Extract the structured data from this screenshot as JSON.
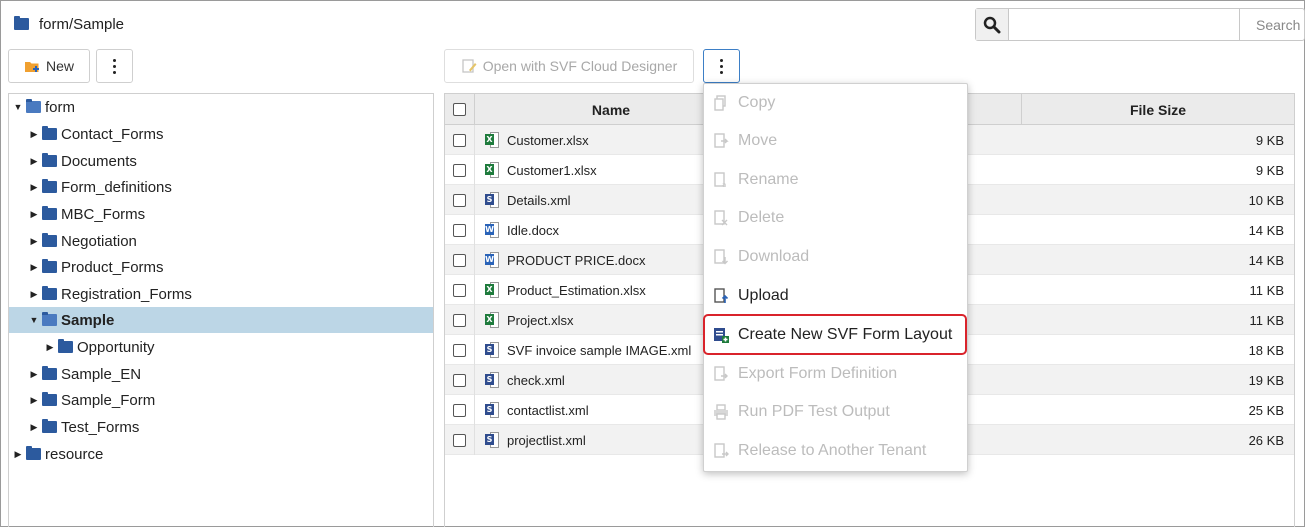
{
  "header": {
    "breadcrumb": "form/Sample"
  },
  "search": {
    "value": "",
    "label": "Search"
  },
  "toolbar": {
    "new_label": "New",
    "open_label": "Open with SVF Cloud Designer"
  },
  "tree": {
    "nodes": [
      {
        "label": "form",
        "expanded": true
      },
      {
        "label": "Contact_Forms"
      },
      {
        "label": "Documents"
      },
      {
        "label": "Form_definitions"
      },
      {
        "label": "MBC_Forms"
      },
      {
        "label": "Negotiation"
      },
      {
        "label": "Product_Forms"
      },
      {
        "label": "Registration_Forms"
      },
      {
        "label": "Sample",
        "selected": true,
        "expanded": true
      },
      {
        "label": "Opportunity"
      },
      {
        "label": "Sample_EN"
      },
      {
        "label": "Sample_Form"
      },
      {
        "label": "Test_Forms"
      },
      {
        "label": "resource"
      }
    ]
  },
  "table": {
    "headers": {
      "name": "Name",
      "size": "File Size"
    },
    "rows": [
      {
        "name": "Customer.xlsx",
        "type": "xlsx",
        "size": "9 KB"
      },
      {
        "name": "Customer1.xlsx",
        "type": "xlsx",
        "size": "9 KB"
      },
      {
        "name": "Details.xml",
        "type": "xml",
        "size": "10 KB"
      },
      {
        "name": "Idle.docx",
        "type": "docx",
        "size": "14 KB"
      },
      {
        "name": "PRODUCT PRICE.docx",
        "type": "docx",
        "size": "14 KB"
      },
      {
        "name": "Product_Estimation.xlsx",
        "type": "xlsx",
        "size": "11 KB"
      },
      {
        "name": "Project.xlsx",
        "type": "xlsx",
        "size": "11 KB"
      },
      {
        "name": "SVF invoice sample IMAGE.xml",
        "type": "xml",
        "size": "18 KB"
      },
      {
        "name": "check.xml",
        "type": "xml",
        "size": "19 KB"
      },
      {
        "name": "contactlist.xml",
        "type": "xml",
        "size": "25 KB"
      },
      {
        "name": "projectlist.xml",
        "type": "xml",
        "size": "26 KB"
      }
    ]
  },
  "menu": {
    "items": [
      {
        "label": "Copy",
        "enabled": false,
        "icon": "copy-icon"
      },
      {
        "label": "Move",
        "enabled": false,
        "icon": "move-icon"
      },
      {
        "label": "Rename",
        "enabled": false,
        "icon": "rename-icon"
      },
      {
        "label": "Delete",
        "enabled": false,
        "icon": "delete-icon"
      },
      {
        "label": "Download",
        "enabled": false,
        "icon": "download-icon"
      },
      {
        "label": "Upload",
        "enabled": true,
        "icon": "upload-icon"
      },
      {
        "label": "Create New SVF Form Layout",
        "enabled": true,
        "icon": "create-layout-icon",
        "highlighted": true
      },
      {
        "label": "Export Form Definition",
        "enabled": false,
        "icon": "export-icon"
      },
      {
        "label": "Run PDF Test Output",
        "enabled": false,
        "icon": "print-icon"
      },
      {
        "label": "Release to Another Tenant",
        "enabled": false,
        "icon": "release-icon"
      }
    ]
  },
  "colors": {
    "selection": "#bcd6e6",
    "highlight_border": "#d9232b",
    "folder": "#2c5a9e"
  }
}
